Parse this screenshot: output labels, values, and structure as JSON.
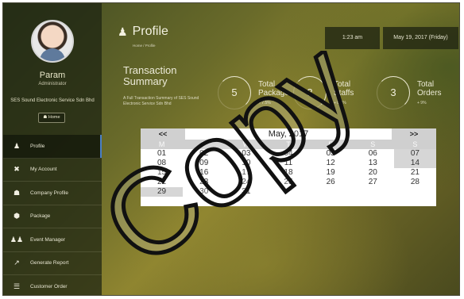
{
  "user": {
    "name": "Param",
    "role": "Administrator",
    "company": "SES Sound Electronic Service Sdn Bhd",
    "home_label": "Home"
  },
  "nav": [
    {
      "label": "Profile",
      "icon": "person-icon"
    },
    {
      "label": "My Account",
      "icon": "tools-icon"
    },
    {
      "label": "Company Profile",
      "icon": "house-icon"
    },
    {
      "label": "Package",
      "icon": "box-icon"
    },
    {
      "label": "Event Manager",
      "icon": "people-icon"
    },
    {
      "label": "Generate Report",
      "icon": "chart-icon"
    },
    {
      "label": "Customer Order",
      "icon": "list-icon"
    }
  ],
  "header": {
    "title": "Profile",
    "breadcrumb": "Home  /  Profile",
    "time": "1:23 am",
    "date": "May 19, 2017 (Friday)"
  },
  "summary": {
    "title": "Transaction Summary",
    "description": "A Full Transaction Summary of SES Sound Electronic Service Sdn Bhd",
    "stats": [
      {
        "value": "5",
        "label_line1": "Total",
        "label_line2": "Package",
        "delta": "+ 7.5%"
      },
      {
        "value": "3",
        "label_line1": "Total",
        "label_line2": "Staffs",
        "delta": "+ 0.6%"
      },
      {
        "value": "3",
        "label_line1": "Total",
        "label_line2": "Orders",
        "delta": "+ 9%"
      }
    ]
  },
  "calendar": {
    "prev": "<<",
    "next": ">>",
    "month": "May, 2017",
    "weekdays": [
      "M",
      "T",
      "W",
      "T",
      "F",
      "S",
      "S"
    ],
    "weeks": [
      [
        "01",
        "02",
        "03",
        "04",
        "05",
        "06",
        "07"
      ],
      [
        "08",
        "09",
        "10",
        "11",
        "12",
        "13",
        "14"
      ],
      [
        "15",
        "16",
        "17",
        "18",
        "19",
        "20",
        "21"
      ],
      [
        "22",
        "23",
        "24",
        "25",
        "26",
        "27",
        "28"
      ],
      [
        "29",
        "30",
        "31",
        "",
        "",
        "",
        ""
      ]
    ]
  },
  "watermark": "Copy"
}
